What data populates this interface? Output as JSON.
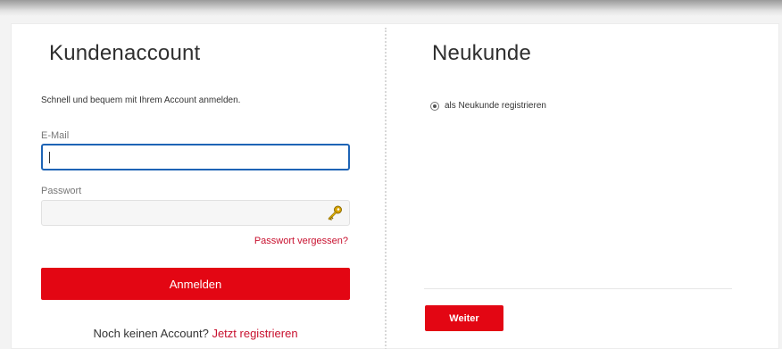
{
  "login": {
    "title": "Kundenaccount",
    "subtitle": "Schnell und bequem mit Ihrem Account anmelden.",
    "email_label": "E-Mail",
    "email_value": "",
    "password_label": "Passwort",
    "password_value": "",
    "forgot_link": "Passwort vergessen?",
    "login_button": "Anmelden",
    "register_prompt": "Noch keinen Account?",
    "register_link": "Jetzt registrieren"
  },
  "new_customer": {
    "title": "Neukunde",
    "radio_label": "als Neukunde registrieren",
    "continue_button": "Weiter"
  },
  "icons": {
    "password_manager": "key-icon",
    "radio": "radio-icon"
  },
  "colors": {
    "accent_red": "#e30613",
    "link_red": "#c8102e",
    "focus_blue": "#1e64b6"
  }
}
